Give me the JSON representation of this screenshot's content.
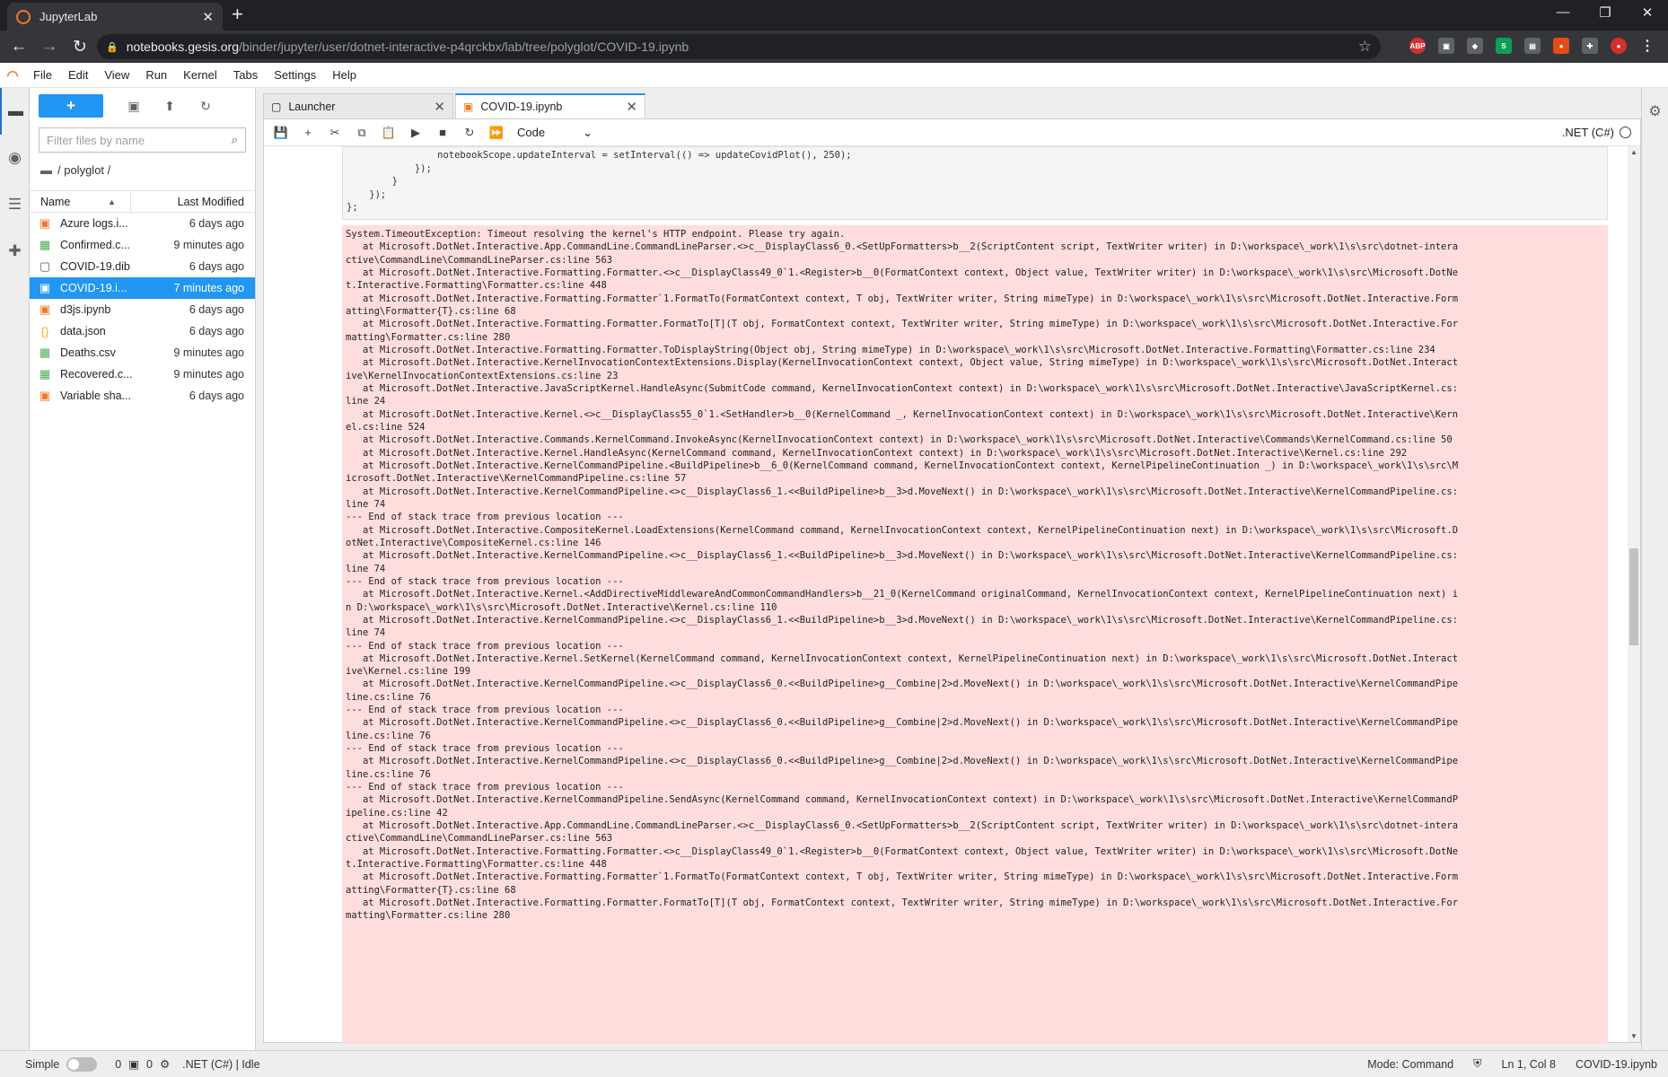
{
  "browser": {
    "tab_title": "JupyterLab",
    "new_tab": "+",
    "url_host": "notebooks.gesis.org",
    "url_path": "/binder/jupyter/user/dotnet-interactive-p4qrckbx/lab/tree/polyglot/COVID-19.ipynb"
  },
  "menu": [
    "File",
    "Edit",
    "View",
    "Run",
    "Kernel",
    "Tabs",
    "Settings",
    "Help"
  ],
  "filebrowser": {
    "new_label": "+",
    "filter_placeholder": "Filter files by name",
    "path": "/ polyglot /",
    "col_name": "Name",
    "col_modified": "Last Modified",
    "files": [
      {
        "name": "Azure logs.i...",
        "modified": "6 days ago",
        "icon": "notebook-icon",
        "color": "#f37726"
      },
      {
        "name": "Confirmed.c...",
        "modified": "9 minutes ago",
        "icon": "spreadsheet-icon",
        "color": "#4caf50"
      },
      {
        "name": "COVID-19.dib",
        "modified": "6 days ago",
        "icon": "file-icon",
        "color": "#616161"
      },
      {
        "name": "COVID-19.i...",
        "modified": "7 minutes ago",
        "icon": "notebook-icon",
        "color": "#ffffff",
        "selected": true
      },
      {
        "name": "d3js.ipynb",
        "modified": "6 days ago",
        "icon": "notebook-icon",
        "color": "#f37726"
      },
      {
        "name": "data.json",
        "modified": "6 days ago",
        "icon": "json-icon",
        "color": "#f9a825"
      },
      {
        "name": "Deaths.csv",
        "modified": "9 minutes ago",
        "icon": "spreadsheet-icon",
        "color": "#4caf50"
      },
      {
        "name": "Recovered.c...",
        "modified": "9 minutes ago",
        "icon": "spreadsheet-icon",
        "color": "#4caf50"
      },
      {
        "name": "Variable sha...",
        "modified": "6 days ago",
        "icon": "notebook-icon",
        "color": "#f37726"
      }
    ]
  },
  "tabs": [
    {
      "label": "Launcher",
      "icon": "launcher-icon",
      "active": false
    },
    {
      "label": "COVID-19.ipynb",
      "icon": "notebook-icon",
      "active": true
    }
  ],
  "notebook": {
    "cell_type": "Code",
    "kernel": ".NET (C#)"
  },
  "code_lines": [
    "                notebookScope.updateInterval = setInterval(() => updateCovidPlot(), 250);",
    "            });",
    "        }",
    "    });",
    "};"
  ],
  "error_lines": [
    "System.TimeoutException: Timeout resolving the kernel's HTTP endpoint. Please try again.",
    "   at Microsoft.DotNet.Interactive.App.CommandLine.CommandLineParser.<>c__DisplayClass6_0.<SetUpFormatters>b__2(ScriptContent script, TextWriter writer) in D:\\workspace\\_work\\1\\s\\src\\dotnet-intera",
    "ctive\\CommandLine\\CommandLineParser.cs:line 563",
    "   at Microsoft.DotNet.Interactive.Formatting.Formatter.<>c__DisplayClass49_0`1.<Register>b__0(FormatContext context, Object value, TextWriter writer) in D:\\workspace\\_work\\1\\s\\src\\Microsoft.DotNe",
    "t.Interactive.Formatting\\Formatter.cs:line 448",
    "   at Microsoft.DotNet.Interactive.Formatting.Formatter`1.FormatTo(FormatContext context, T obj, TextWriter writer, String mimeType) in D:\\workspace\\_work\\1\\s\\src\\Microsoft.DotNet.Interactive.Form",
    "atting\\Formatter{T}.cs:line 68",
    "   at Microsoft.DotNet.Interactive.Formatting.Formatter.FormatTo[T](T obj, FormatContext context, TextWriter writer, String mimeType) in D:\\workspace\\_work\\1\\s\\src\\Microsoft.DotNet.Interactive.For",
    "matting\\Formatter.cs:line 280",
    "   at Microsoft.DotNet.Interactive.Formatting.Formatter.ToDisplayString(Object obj, String mimeType) in D:\\workspace\\_work\\1\\s\\src\\Microsoft.DotNet.Interactive.Formatting\\Formatter.cs:line 234",
    "   at Microsoft.DotNet.Interactive.KernelInvocationContextExtensions.Display(KernelInvocationContext context, Object value, String mimeType) in D:\\workspace\\_work\\1\\s\\src\\Microsoft.DotNet.Interact",
    "ive\\KernelInvocationContextExtensions.cs:line 23",
    "   at Microsoft.DotNet.Interactive.JavaScriptKernel.HandleAsync(SubmitCode command, KernelInvocationContext context) in D:\\workspace\\_work\\1\\s\\src\\Microsoft.DotNet.Interactive\\JavaScriptKernel.cs:",
    "line 24",
    "   at Microsoft.DotNet.Interactive.Kernel.<>c__DisplayClass55_0`1.<SetHandler>b__0(KernelCommand _, KernelInvocationContext context) in D:\\workspace\\_work\\1\\s\\src\\Microsoft.DotNet.Interactive\\Kern",
    "el.cs:line 524",
    "   at Microsoft.DotNet.Interactive.Commands.KernelCommand.InvokeAsync(KernelInvocationContext context) in D:\\workspace\\_work\\1\\s\\src\\Microsoft.DotNet.Interactive\\Commands\\KernelCommand.cs:line 50",
    "   at Microsoft.DotNet.Interactive.Kernel.HandleAsync(KernelCommand command, KernelInvocationContext context) in D:\\workspace\\_work\\1\\s\\src\\Microsoft.DotNet.Interactive\\Kernel.cs:line 292",
    "   at Microsoft.DotNet.Interactive.KernelCommandPipeline.<BuildPipeline>b__6_0(KernelCommand command, KernelInvocationContext context, KernelPipelineContinuation _) in D:\\workspace\\_work\\1\\s\\src\\M",
    "icrosoft.DotNet.Interactive\\KernelCommandPipeline.cs:line 57",
    "   at Microsoft.DotNet.Interactive.KernelCommandPipeline.<>c__DisplayClass6_1.<<BuildPipeline>b__3>d.MoveNext() in D:\\workspace\\_work\\1\\s\\src\\Microsoft.DotNet.Interactive\\KernelCommandPipeline.cs:",
    "line 74",
    "--- End of stack trace from previous location ---",
    "   at Microsoft.DotNet.Interactive.CompositeKernel.LoadExtensions(KernelCommand command, KernelInvocationContext context, KernelPipelineContinuation next) in D:\\workspace\\_work\\1\\s\\src\\Microsoft.D",
    "otNet.Interactive\\CompositeKernel.cs:line 146",
    "   at Microsoft.DotNet.Interactive.KernelCommandPipeline.<>c__DisplayClass6_1.<<BuildPipeline>b__3>d.MoveNext() in D:\\workspace\\_work\\1\\s\\src\\Microsoft.DotNet.Interactive\\KernelCommandPipeline.cs:",
    "line 74",
    "--- End of stack trace from previous location ---",
    "   at Microsoft.DotNet.Interactive.Kernel.<AddDirectiveMiddlewareAndCommonCommandHandlers>b__21_0(KernelCommand originalCommand, KernelInvocationContext context, KernelPipelineContinuation next) i",
    "n D:\\workspace\\_work\\1\\s\\src\\Microsoft.DotNet.Interactive\\Kernel.cs:line 110",
    "   at Microsoft.DotNet.Interactive.KernelCommandPipeline.<>c__DisplayClass6_1.<<BuildPipeline>b__3>d.MoveNext() in D:\\workspace\\_work\\1\\s\\src\\Microsoft.DotNet.Interactive\\KernelCommandPipeline.cs:",
    "line 74",
    "--- End of stack trace from previous location ---",
    "   at Microsoft.DotNet.Interactive.Kernel.SetKernel(KernelCommand command, KernelInvocationContext context, KernelPipelineContinuation next) in D:\\workspace\\_work\\1\\s\\src\\Microsoft.DotNet.Interact",
    "ive\\Kernel.cs:line 199",
    "   at Microsoft.DotNet.Interactive.KernelCommandPipeline.<>c__DisplayClass6_0.<<BuildPipeline>g__Combine|2>d.MoveNext() in D:\\workspace\\_work\\1\\s\\src\\Microsoft.DotNet.Interactive\\KernelCommandPipe",
    "line.cs:line 76",
    "--- End of stack trace from previous location ---",
    "   at Microsoft.DotNet.Interactive.KernelCommandPipeline.<>c__DisplayClass6_0.<<BuildPipeline>g__Combine|2>d.MoveNext() in D:\\workspace\\_work\\1\\s\\src\\Microsoft.DotNet.Interactive\\KernelCommandPipe",
    "line.cs:line 76",
    "--- End of stack trace from previous location ---",
    "   at Microsoft.DotNet.Interactive.KernelCommandPipeline.<>c__DisplayClass6_0.<<BuildPipeline>g__Combine|2>d.MoveNext() in D:\\workspace\\_work\\1\\s\\src\\Microsoft.DotNet.Interactive\\KernelCommandPipe",
    "line.cs:line 76",
    "--- End of stack trace from previous location ---",
    "   at Microsoft.DotNet.Interactive.KernelCommandPipeline.SendAsync(KernelCommand command, KernelInvocationContext context) in D:\\workspace\\_work\\1\\s\\src\\Microsoft.DotNet.Interactive\\KernelCommandP",
    "ipeline.cs:line 42",
    "   at Microsoft.DotNet.Interactive.App.CommandLine.CommandLineParser.<>c__DisplayClass6_0.<SetUpFormatters>b__2(ScriptContent script, TextWriter writer) in D:\\workspace\\_work\\1\\s\\src\\dotnet-intera",
    "ctive\\CommandLine\\CommandLineParser.cs:line 563",
    "   at Microsoft.DotNet.Interactive.Formatting.Formatter.<>c__DisplayClass49_0`1.<Register>b__0(FormatContext context, Object value, TextWriter writer) in D:\\workspace\\_work\\1\\s\\src\\Microsoft.DotNe",
    "t.Interactive.Formatting\\Formatter.cs:line 448",
    "   at Microsoft.DotNet.Interactive.Formatting.Formatter`1.FormatTo(FormatContext context, T obj, TextWriter writer, String mimeType) in D:\\workspace\\_work\\1\\s\\src\\Microsoft.DotNet.Interactive.Form",
    "atting\\Formatter{T}.cs:line 68",
    "   at Microsoft.DotNet.Interactive.Formatting.Formatter.FormatTo[T](T obj, FormatContext context, TextWriter writer, String mimeType) in D:\\workspace\\_work\\1\\s\\src\\Microsoft.DotNet.Interactive.For",
    "matting\\Formatter.cs:line 280"
  ],
  "statusbar": {
    "mode_label": "Simple",
    "count_a": "0",
    "count_b": "0",
    "kernel_state": ".NET (C#) | Idle",
    "mode": "Mode: Command",
    "position": "Ln 1, Col 8",
    "filename": "COVID-19.ipynb"
  }
}
